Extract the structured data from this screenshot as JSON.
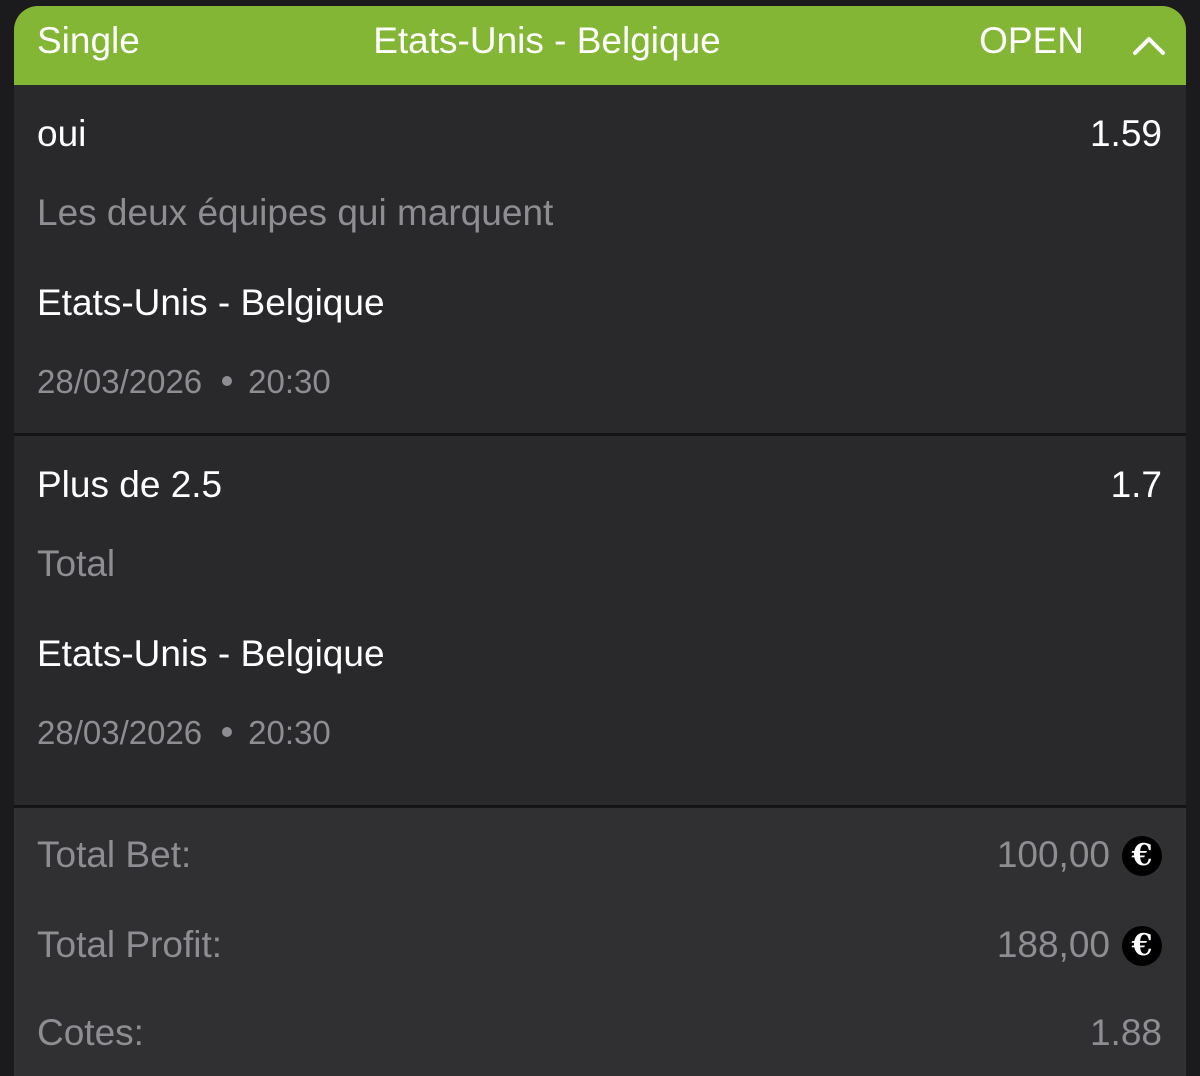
{
  "header": {
    "bet_type": "Single",
    "match": "Etats-Unis - Belgique",
    "status": "OPEN",
    "accent_color": "#83b635"
  },
  "selections": [
    {
      "pick": "oui",
      "odds": "1.59",
      "market": "Les deux équipes qui marquent",
      "event": "Etats-Unis - Belgique",
      "date": "28/03/2026",
      "time": "20:30"
    },
    {
      "pick": "Plus de 2.5",
      "odds": "1.7",
      "market": "Total",
      "event": "Etats-Unis - Belgique",
      "date": "28/03/2026",
      "time": "20:30"
    }
  ],
  "summary": {
    "total_bet_label": "Total Bet:",
    "total_bet_value": "100,00",
    "total_profit_label": "Total Profit:",
    "total_profit_value": "188,00",
    "odds_label": "Cotes:",
    "odds_value": "1.88",
    "currency_symbol": "€"
  },
  "icons": {
    "collapse": "chevron-up-icon",
    "currency": "euro-icon"
  }
}
